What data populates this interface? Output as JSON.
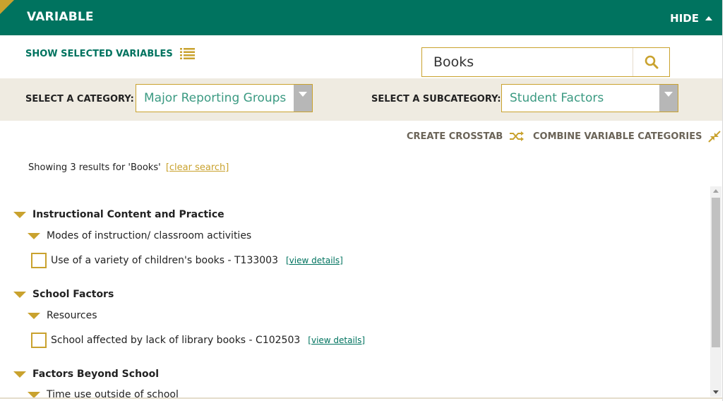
{
  "header": {
    "title": "VARIABLE",
    "hide_label": "HIDE"
  },
  "show_selected_label": "SHOW SELECTED VARIABLES",
  "search": {
    "value": "Books",
    "placeholder": ""
  },
  "category": {
    "label": "SELECT A CATEGORY:",
    "selected": "Major Reporting Groups"
  },
  "subcategory": {
    "label": "SELECT A SUBCATEGORY:",
    "selected": "Student Factors"
  },
  "tools": {
    "crosstab_label": "CREATE CROSSTAB",
    "combine_label": "COMBINE VARIABLE CATEGORIES"
  },
  "results_info": {
    "text": "Showing 3 results for 'Books'",
    "clear_label": "[clear search]"
  },
  "groups": [
    {
      "name": "Instructional Content and Practice",
      "subgroup": "Modes of instruction/ classroom activities",
      "variable": "Use of a variety of children's books - T133003",
      "details_label": "[view details]"
    },
    {
      "name": "School Factors",
      "subgroup": "Resources",
      "variable": "School affected by lack of library books - C102503",
      "details_label": "[view details]"
    },
    {
      "name": "Factors Beyond School",
      "subgroup": "Time use outside of school"
    }
  ],
  "colors": {
    "brand_green": "#00735f",
    "accent_gold": "#c9a22e",
    "band_beige": "#efebe1"
  },
  "icons": [
    "list-icon",
    "search-icon",
    "shuffle-icon",
    "compress-icon",
    "caret-up-icon",
    "triangle-down-icon"
  ]
}
